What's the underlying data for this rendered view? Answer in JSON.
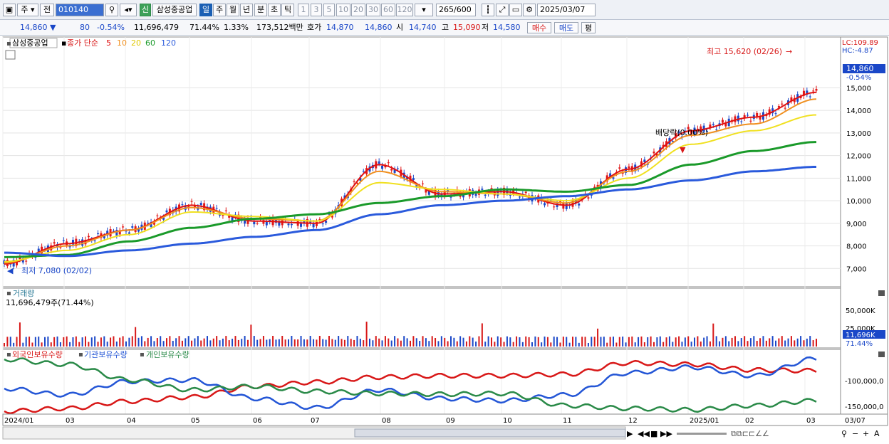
{
  "toolbar": {
    "period_type": "주",
    "prev": "전",
    "code": "010140",
    "badge": "신",
    "stock_name": "삼성중공업",
    "periods": [
      "일",
      "주",
      "월",
      "년",
      "분",
      "초",
      "틱"
    ],
    "intervals": [
      "1",
      "3",
      "5",
      "10",
      "20",
      "30",
      "60",
      "120"
    ],
    "count": "265",
    "count_total": "/600",
    "date": "2025/03/07"
  },
  "infobar": {
    "price": "14,860",
    "change": "80",
    "change_pct": "-0.54%",
    "volume": "11,696,479",
    "volume_ratio": "71.44%",
    "turnover": "1.33%",
    "amount": "173,512백만",
    "quote_label": "호가",
    "ask": "14,870",
    "bid": "14,860",
    "open_label": "시",
    "open": "14,740",
    "high_label": "고",
    "high": "15,090",
    "low_label": "저",
    "low": "14,580",
    "buy": "매수",
    "sell": "매도",
    "eval": "평"
  },
  "price_panel": {
    "legend_name": "삼성중공업",
    "legend_ma": "종가 단순",
    "ma_periods": [
      "5",
      "10",
      "20",
      "60",
      "120"
    ],
    "ma_colors": [
      "#e01010",
      "#f09020",
      "#f0e020",
      "#1a9a2a",
      "#2a5adc"
    ],
    "lc": "LC:109.89",
    "hc": "HC:-4.87",
    "last_price": "14,860",
    "last_pct": "-0.54%",
    "high_annot": "최고 15,620 (02/26)",
    "low_annot": "최저 7,080 (02/02)",
    "dividend": "배당락(0.00%)",
    "y_ticks": [
      "15,000",
      "14,000",
      "13,000",
      "12,000",
      "11,000",
      "10,000",
      "9,000",
      "8,000",
      "7,000"
    ]
  },
  "volume_panel": {
    "title": "거래량",
    "value": "11,696,479주(71.44%)",
    "y_ticks": [
      "50,000K",
      "25,000K"
    ],
    "last": "11,696K",
    "last_pct": "71.44%"
  },
  "holding_panel": {
    "series": [
      "외국인보유수량",
      "기관보유수량",
      "개인보유수량"
    ],
    "colors": [
      "#d81818",
      "#2456d6",
      "#2a8a48"
    ],
    "y_ticks": [
      "-100,000,0",
      "-150,000,0"
    ]
  },
  "x_axis": [
    "2024/01",
    "03",
    "04",
    "05",
    "06",
    "07",
    "08",
    "09",
    "10",
    "11",
    "12",
    "2025/01",
    "02",
    "03",
    "03/07"
  ],
  "chart_data": {
    "type": "line",
    "title": "삼성중공업",
    "xlabel": "",
    "ylabel": "",
    "x": [
      "2024/01",
      "03",
      "04",
      "05",
      "06",
      "07",
      "08",
      "09",
      "10",
      "11",
      "12",
      "2025/01",
      "02",
      "03"
    ],
    "ylim": [
      6600,
      15800
    ],
    "series": [
      {
        "name": "5",
        "values": [
          7200,
          8100,
          8700,
          9800,
          9100,
          9000,
          11600,
          10300,
          10400,
          9800,
          11400,
          13100,
          13700,
          14800
        ]
      },
      {
        "name": "10",
        "values": [
          7250,
          8000,
          8700,
          9700,
          9200,
          9100,
          11300,
          10400,
          10300,
          9900,
          11300,
          12900,
          13400,
          14500
        ]
      },
      {
        "name": "20",
        "values": [
          7300,
          7800,
          8500,
          9500,
          9300,
          9100,
          10800,
          10500,
          10300,
          10000,
          11000,
          12500,
          13100,
          13800
        ]
      },
      {
        "name": "60",
        "values": [
          7500,
          7600,
          8200,
          8800,
          9200,
          9400,
          9900,
          10200,
          10500,
          10400,
          10700,
          11600,
          12200,
          12600
        ]
      },
      {
        "name": "120",
        "values": [
          7700,
          7550,
          7800,
          8100,
          8400,
          8700,
          9400,
          9800,
          10000,
          10200,
          10500,
          10900,
          11300,
          11500
        ]
      }
    ],
    "annotations": [
      "최고 15,620 (02/26)",
      "최저 7,080 (02/02)",
      "배당락(0.00%)"
    ]
  }
}
